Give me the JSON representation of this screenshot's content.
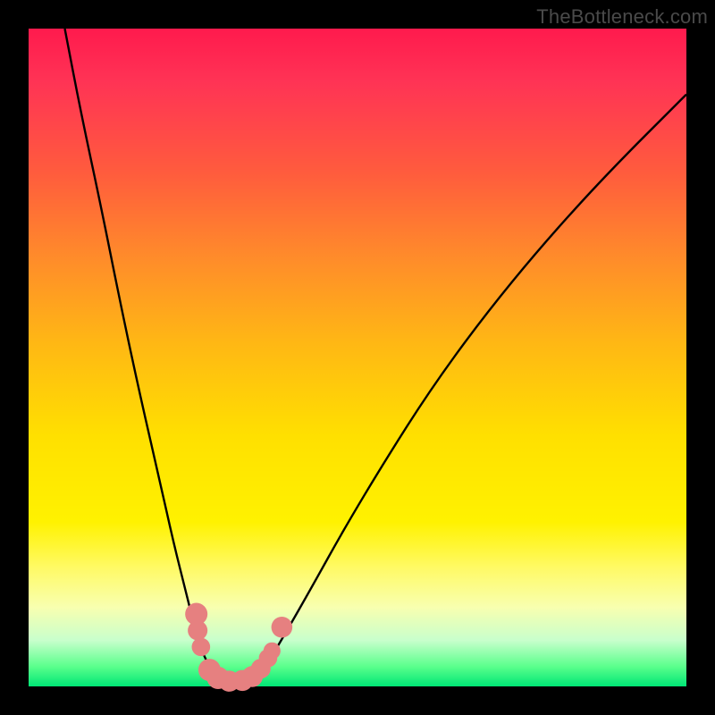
{
  "watermark": "TheBottleneck.com",
  "chart_data": {
    "type": "line",
    "title": "",
    "xlabel": "",
    "ylabel": "",
    "xlim": [
      0,
      100
    ],
    "ylim": [
      0,
      100
    ],
    "grid": false,
    "legend": false,
    "series": [
      {
        "name": "left-curve",
        "x": [
          5.5,
          8,
          11,
          14,
          17,
          20,
          22,
          24,
          25.5,
          26.5,
          27.5,
          28.2,
          29
        ],
        "y": [
          100,
          87,
          73,
          58,
          44,
          31,
          22,
          14,
          8,
          5,
          3,
          1.5,
          0
        ]
      },
      {
        "name": "right-curve",
        "x": [
          34,
          36,
          39,
          43,
          48,
          54,
          61,
          69,
          78,
          88,
          100
        ],
        "y": [
          0,
          3,
          8,
          15,
          24,
          34,
          45,
          56,
          67,
          78,
          90
        ]
      }
    ],
    "markers": [
      {
        "name": "left-marker-1",
        "x": 25.5,
        "y": 11,
        "r": 1.7
      },
      {
        "name": "left-marker-2",
        "x": 25.7,
        "y": 8.5,
        "r": 1.5
      },
      {
        "name": "left-marker-3",
        "x": 26.2,
        "y": 6,
        "r": 1.4
      },
      {
        "name": "left-marker-4",
        "x": 27.5,
        "y": 2.5,
        "r": 1.7
      },
      {
        "name": "left-marker-5",
        "x": 28.8,
        "y": 1.3,
        "r": 1.7
      },
      {
        "name": "left-marker-6",
        "x": 30.5,
        "y": 0.8,
        "r": 1.6
      },
      {
        "name": "right-marker-1",
        "x": 32.5,
        "y": 0.9,
        "r": 1.6
      },
      {
        "name": "right-marker-2",
        "x": 34,
        "y": 1.5,
        "r": 1.6
      },
      {
        "name": "right-marker-3",
        "x": 35.3,
        "y": 2.7,
        "r": 1.5
      },
      {
        "name": "right-marker-4",
        "x": 36.4,
        "y": 4.3,
        "r": 1.4
      },
      {
        "name": "right-marker-5",
        "x": 37,
        "y": 5.4,
        "r": 1.3
      },
      {
        "name": "right-marker-6",
        "x": 38.5,
        "y": 9,
        "r": 1.6
      }
    ],
    "marker_color": "#e68080",
    "curve_color": "#000000",
    "curve_width": 2.4
  }
}
